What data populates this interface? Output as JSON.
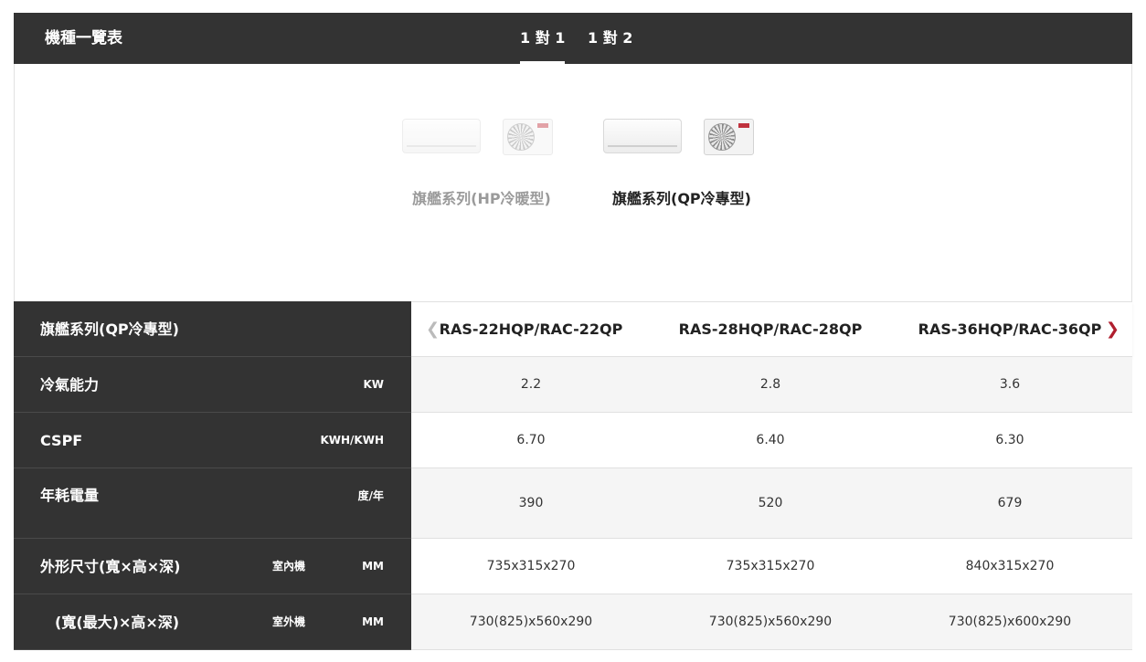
{
  "header": {
    "title": "機種一覽表",
    "tabs": [
      {
        "label": "1 對 1",
        "active": true
      },
      {
        "label": "1 對 2",
        "active": false
      }
    ]
  },
  "series": [
    {
      "name": "旗艦系列(HP冷暖型)",
      "selected": false
    },
    {
      "name": "旗艦系列(QP冷專型)",
      "selected": true
    }
  ],
  "spec_table": {
    "series_title": "旗艦系列(QP冷專型)",
    "nav": {
      "prev_icon": "chevron-left-icon",
      "next_icon": "chevron-right-icon"
    },
    "models": [
      "RAS-22HQP/RAC-22QP",
      "RAS-28HQP/RAC-28QP",
      "RAS-36HQP/RAC-36QP"
    ],
    "rows": [
      {
        "label": "冷氣能力",
        "sub": "",
        "unit": "KW",
        "values": [
          "2.2",
          "2.8",
          "3.6"
        ]
      },
      {
        "label": "CSPF",
        "sub": "",
        "unit": "KWH/KWH",
        "values": [
          "6.70",
          "6.40",
          "6.30"
        ]
      },
      {
        "label": "年耗電量",
        "sub": "",
        "unit": "度/年",
        "values": [
          "390",
          "520",
          "679"
        ]
      },
      {
        "label": "外形尺寸(寬×高×深)",
        "sub": "室內機",
        "unit": "MM",
        "values": [
          "735x315x270",
          "735x315x270",
          "840x315x270"
        ]
      },
      {
        "label": "(寬(最大)×高×深)",
        "sub": "室外機",
        "unit": "MM",
        "values": [
          "730(825)x560x290",
          "730(825)x560x290",
          "730(825)x600x290"
        ]
      }
    ]
  },
  "colors": {
    "dark_bar": "#333333",
    "accent": "#b01e2e"
  }
}
